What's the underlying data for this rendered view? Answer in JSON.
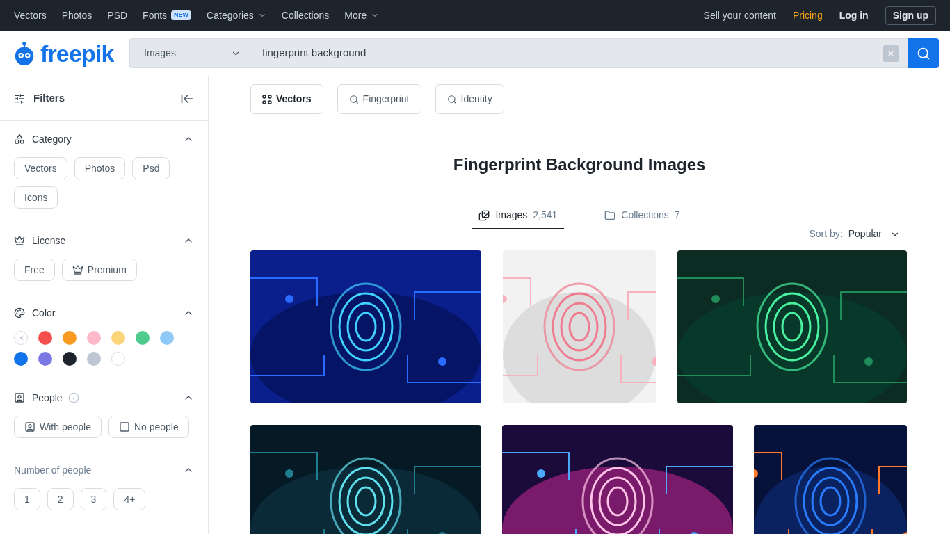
{
  "top_nav": {
    "links": [
      {
        "label": "Vectors"
      },
      {
        "label": "Photos"
      },
      {
        "label": "PSD"
      },
      {
        "label": "Fonts",
        "badge": "NEW"
      },
      {
        "label": "Categories",
        "dropdown": true
      },
      {
        "label": "Collections"
      },
      {
        "label": "More",
        "dropdown": true
      }
    ],
    "right": [
      {
        "label": "Sell your content",
        "kind": "link"
      },
      {
        "label": "Pricing",
        "kind": "highlight"
      },
      {
        "label": "Log in",
        "kind": "strong"
      },
      {
        "label": "Sign up",
        "kind": "outline"
      }
    ]
  },
  "header": {
    "logo": "freepik",
    "search": {
      "type": "Images",
      "value": "fingerprint background"
    }
  },
  "sidebar": {
    "title": "Filters",
    "sections": [
      {
        "kind": "chips",
        "title": "Category",
        "options": [
          {
            "label": "Vectors",
            "selected": false
          },
          {
            "label": "Photos",
            "selected": false
          },
          {
            "label": "Psd",
            "selected": false
          },
          {
            "label": "Icons",
            "selected": false
          }
        ]
      },
      {
        "kind": "chips",
        "title": "License",
        "options": [
          {
            "label": "Free",
            "selected": false
          },
          {
            "label": "Premium",
            "selected": false
          }
        ]
      },
      {
        "kind": "colors",
        "title": "Color",
        "colors": [
          {
            "color": "#ffffff",
            "none": true,
            "selected": false
          },
          {
            "color": "#f5504f",
            "selected": false
          },
          {
            "color": "#f99b22",
            "selected": false
          },
          {
            "color": "#fdb9c9",
            "selected": false
          },
          {
            "color": "#fcd57a",
            "selected": false
          },
          {
            "color": "#4ecb8d",
            "selected": false
          },
          {
            "color": "#8ec9f7",
            "selected": false
          },
          {
            "color": "#1273eb",
            "selected": false
          },
          {
            "color": "#7b78e6",
            "selected": false
          },
          {
            "color": "#1d242c",
            "selected": false
          },
          {
            "color": "#bdc6d1",
            "selected": false
          },
          {
            "color": "#ffffff",
            "selected": false
          }
        ]
      },
      {
        "kind": "chips",
        "title": "People",
        "info": true,
        "options": [
          {
            "label": "With people",
            "selected": false
          },
          {
            "label": "No people",
            "selected": false
          }
        ]
      },
      {
        "kind": "chips",
        "title": "Number of people",
        "disabled": true,
        "options": [
          {
            "label": "1",
            "selected": false
          },
          {
            "label": "2",
            "selected": false
          },
          {
            "label": "3",
            "selected": false
          },
          {
            "label": "4+",
            "selected": false
          }
        ]
      }
    ]
  },
  "related": [
    {
      "label": "Vectors",
      "kind": "format"
    },
    {
      "label": "Fingerprint",
      "kind": "search"
    },
    {
      "label": "Identity",
      "kind": "search"
    }
  ],
  "heading": "Fingerprint Background Images",
  "tabs": [
    {
      "label": "Images",
      "count": "2,541",
      "selected": true
    },
    {
      "label": "Collections",
      "count": "7",
      "selected": false
    }
  ],
  "sort": {
    "label": "Sort by:",
    "value": "Popular"
  }
}
